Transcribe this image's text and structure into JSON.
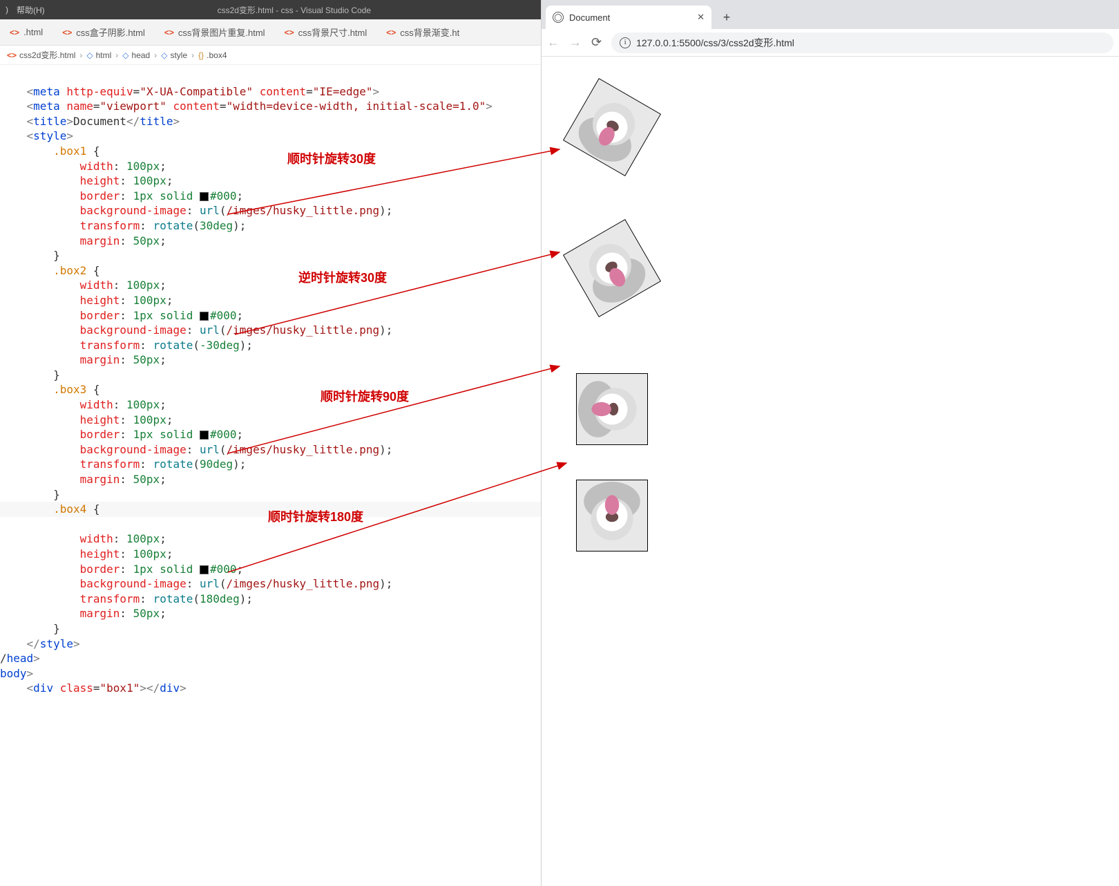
{
  "vscode": {
    "menu_help": "帮助(H)",
    "window_title": "css2d变形.html - css - Visual Studio Code",
    "tabs": [
      ".html",
      "css盒子阴影.html",
      "css背景图片重复.html",
      "css背景尺寸.html",
      "css背景渐变.ht"
    ],
    "breadcrumbs": [
      "css2d变形.html",
      "html",
      "head",
      "style",
      ".box4"
    ],
    "code": {
      "meta1_attr1": "http-equiv",
      "meta1_val1": "\"X-UA-Compatible\"",
      "meta1_attr2": "content",
      "meta1_val2": "\"IE=edge\"",
      "meta2_attr1": "name",
      "meta2_val1": "\"viewport\"",
      "meta2_attr2": "content",
      "meta2_val2": "\"width=device-width, initial-scale=1.0\"",
      "title_text": "Document",
      "box1": ".box1",
      "box2": ".box2",
      "box3": ".box3",
      "box4": ".box4",
      "width": "width",
      "height": "height",
      "border": "border",
      "bgimg": "background-image",
      "transform": "transform",
      "margin": "margin",
      "px100": "100px",
      "solid1px": "1px solid ",
      "black": "#000",
      "url": "url",
      "imgpath": "/imges/husky_little.png",
      "m50": "50px",
      "rot": "rotate",
      "deg30": "30deg",
      "degm30": "-30deg",
      "deg90": "90deg",
      "deg180": "180deg",
      "div": "div",
      "class": "class",
      "box1v": "\"box1\"",
      "style": "style",
      "head": "head",
      "body": "body",
      "title": "title",
      "meta": "meta"
    },
    "annotations": {
      "a1": "顺时针旋转30度",
      "a2": "逆时针旋转30度",
      "a3": "顺时针旋转90度",
      "a4": "顺时针旋转180度"
    }
  },
  "chrome": {
    "tab_title": "Document",
    "url": "127.0.0.1:5500/css/3/css2d变形.html"
  }
}
